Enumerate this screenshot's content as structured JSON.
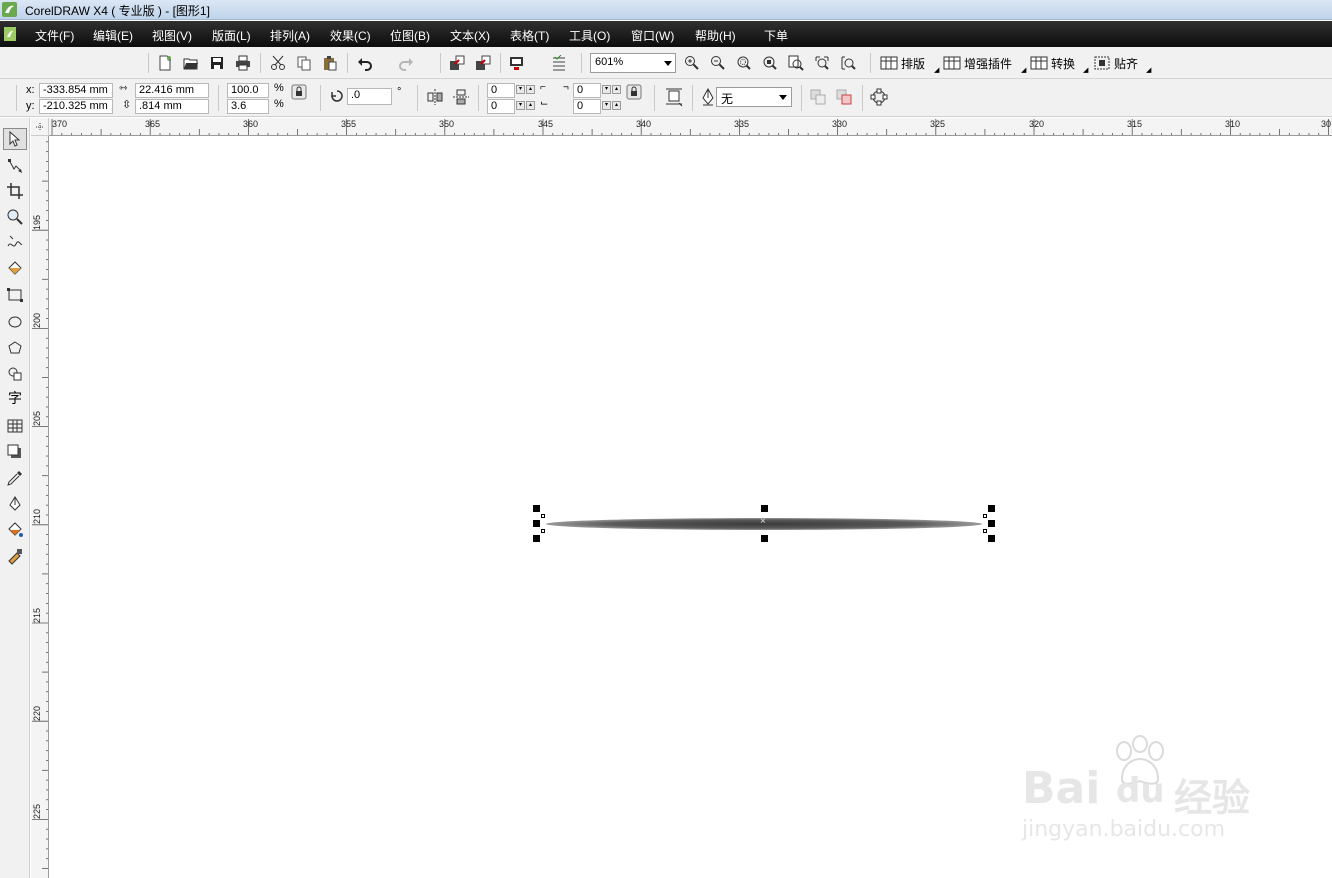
{
  "window": {
    "title": "CorelDRAW X4 ( 专业版 ) - [图形1]"
  },
  "menu": [
    {
      "label": "文件(F)"
    },
    {
      "label": "编辑(E)"
    },
    {
      "label": "视图(V)"
    },
    {
      "label": "版面(L)"
    },
    {
      "label": "排列(A)"
    },
    {
      "label": "效果(C)"
    },
    {
      "label": "位图(B)"
    },
    {
      "label": "文本(X)"
    },
    {
      "label": "表格(T)"
    },
    {
      "label": "工具(O)"
    },
    {
      "label": "窗口(W)"
    },
    {
      "label": "帮助(H)"
    },
    {
      "label": "下单"
    }
  ],
  "toolbar": {
    "zoom_value": "601%",
    "text_buttons": [
      {
        "label": "排版"
      },
      {
        "label": "增强插件"
      },
      {
        "label": "转换"
      },
      {
        "label": "贴齐"
      }
    ]
  },
  "properties": {
    "x_label": "x:",
    "x_value": "-333.854 mm",
    "y_label": "y:",
    "y_value": "-210.325 mm",
    "width_value": "22.416 mm",
    "height_value": ".814 mm",
    "scale_x": "100.0",
    "scale_y": "3.6",
    "percent": "%",
    "rotation": ".0",
    "degree": "°",
    "corner_tl": "0",
    "corner_bl": "0",
    "corner_tr": "0",
    "corner_br": "0",
    "outline_width": "无"
  },
  "ruler": {
    "horizontal": [
      "370",
      "365",
      "360",
      "355",
      "350",
      "345",
      "340",
      "335",
      "330",
      "325",
      "320",
      "315",
      "310",
      "30"
    ],
    "vertical": [
      "195",
      "200",
      "205",
      "210",
      "215",
      "220",
      "225"
    ]
  },
  "watermark": {
    "brand": "Bai",
    "brand2": "du",
    "brand3": "经验",
    "url": "jingyan.baidu.com"
  },
  "colors": {
    "menubar": "#1a1a1a",
    "shape": "#4a4a4a",
    "titlebar": "#c8d9ee"
  }
}
